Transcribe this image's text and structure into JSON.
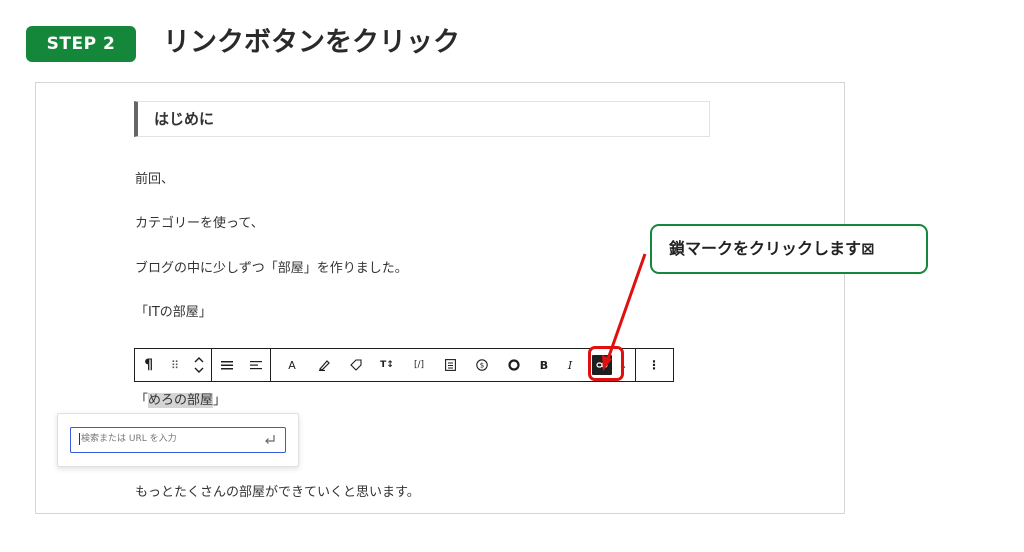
{
  "step": {
    "badge": "STEP 2",
    "title": "リンクボタンをクリック"
  },
  "editor": {
    "heading": "はじめに",
    "paragraphs": [
      "前回、",
      "カテゴリーを使って、",
      "ブログの中に少しずつ「部屋」を作りました。",
      "「ITの部屋」"
    ],
    "selected_line": {
      "open_bracket": "「",
      "selected_text": "めろの部屋",
      "close_bracket": "」"
    },
    "last_paragraph": "もっとたくさんの部屋ができていくと思います。"
  },
  "toolbar": {
    "paragraph_icon": "paragraph-icon",
    "drag_icon": "drag-handle-icon",
    "move_icon": "move-up-down-icon",
    "items": [
      {
        "name": "align-icon",
        "glyph": "☰"
      },
      {
        "name": "align-left-icon",
        "glyph": "≡"
      },
      {
        "name": "text-color-button",
        "glyph": "A"
      },
      {
        "name": "highlight-button",
        "glyph": "✎"
      },
      {
        "name": "tag-button",
        "glyph": "◇"
      },
      {
        "name": "font-size-button",
        "glyph": "T↕"
      },
      {
        "name": "code-button",
        "glyph": "[/]"
      },
      {
        "name": "list-button",
        "glyph": "▤"
      },
      {
        "name": "badge-button",
        "glyph": "⑤"
      },
      {
        "name": "circle-button",
        "glyph": "●"
      },
      {
        "name": "bold-button",
        "glyph": "B"
      },
      {
        "name": "italic-button",
        "glyph": "I"
      }
    ],
    "link_icon": "link-icon",
    "more_icon": "more-icon",
    "arrow_icon": "chevron-right-icon"
  },
  "link_popover": {
    "placeholder": "検索または URL を入力",
    "submit_icon": "enter-icon"
  },
  "callout": {
    "text": "鎖マークをクリックします⊠"
  },
  "colors": {
    "green": "#15873a",
    "red": "#e01010",
    "input_focus": "#3a5bdc"
  }
}
